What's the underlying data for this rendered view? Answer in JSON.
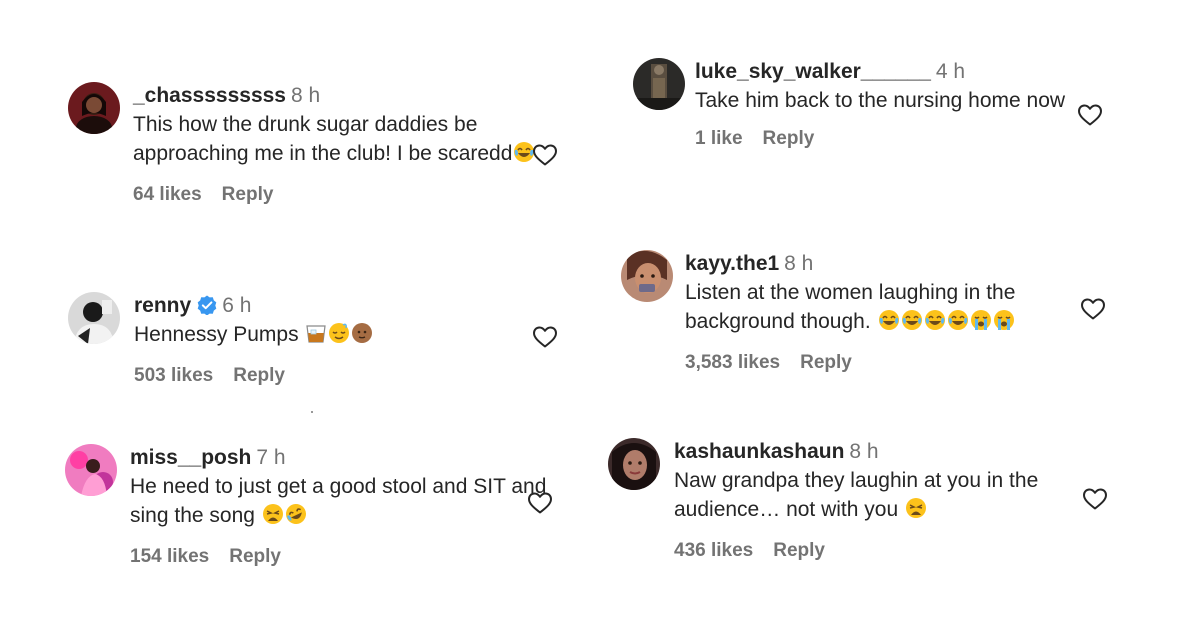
{
  "comments": [
    {
      "username": "_chasssssssss",
      "time": "8 h",
      "text": "This how the drunk sugar daddies be approaching me in the club! I be scaredd",
      "emojis": [
        "tears-of-joy"
      ],
      "likes": "64 likes",
      "reply": "Reply",
      "verified": false
    },
    {
      "username": "renny",
      "time": "6 h",
      "text": "Hennessy Pumps",
      "emojis": [
        "tumbler-glass",
        "relieved-face",
        "bald-head"
      ],
      "likes": "503 likes",
      "reply": "Reply",
      "verified": true
    },
    {
      "username": "miss__posh",
      "time": "7 h",
      "text": "He need to just get a good stool and SIT and sing the song",
      "emojis": [
        "weary-face",
        "rolling-laughing"
      ],
      "likes": "154 likes",
      "reply": "Reply",
      "verified": false
    },
    {
      "username": "luke_sky_walker______",
      "time": "4 h",
      "text": "Take him back to the nursing home now",
      "emojis": [],
      "likes": "1 like",
      "reply": "Reply",
      "verified": false
    },
    {
      "username": "kayy.the1",
      "time": "8 h",
      "text": "Listen at the women laughing in the background though.",
      "emojis": [
        "tears-of-joy",
        "tears-of-joy",
        "tears-of-joy",
        "tears-of-joy",
        "loudly-crying",
        "loudly-crying"
      ],
      "likes": "3,583 likes",
      "reply": "Reply",
      "verified": false
    },
    {
      "username": "kashaunkashaun",
      "time": "8 h",
      "text": "Naw grandpa they laughin at you in the audience… not with you",
      "emojis": [
        "weary-face"
      ],
      "likes": "436 likes",
      "reply": "Reply",
      "verified": false
    }
  ],
  "colors": {
    "text": "#262626",
    "secondary": "#737373",
    "verified": "#3897f0",
    "emoji_yellow": "#fcc21b"
  }
}
